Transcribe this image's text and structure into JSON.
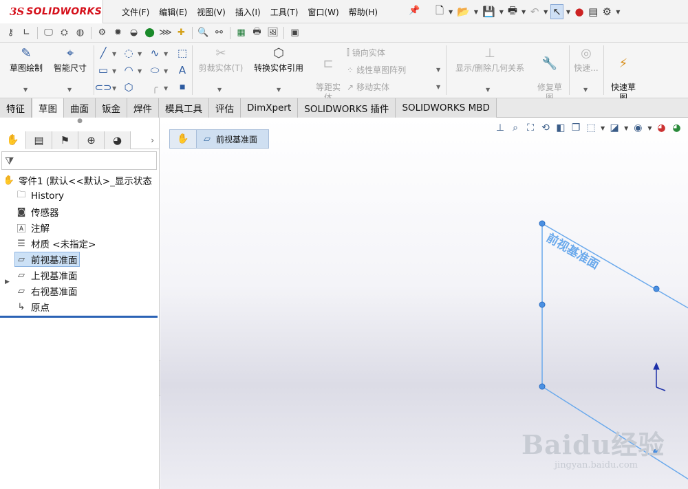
{
  "app": {
    "logo_ds": "3S",
    "logo_word": "SOLIDWORKS"
  },
  "menu": [
    "文件(F)",
    "编辑(E)",
    "视图(V)",
    "插入(I)",
    "工具(T)",
    "窗口(W)",
    "帮助(H)"
  ],
  "command_manager": {
    "sketch": "草图绘制",
    "smart_dimension": "智能尺寸",
    "trim": "剪裁实体(T)",
    "convert": "转换实体引用",
    "offset": "等距实\n体",
    "mirror": "镜向实体",
    "linear_pattern": "线性草图阵列",
    "move": "移动实体",
    "relations": "显示/删除几何关系",
    "repair": "修复草\n图",
    "quick_snaps": "快速...",
    "rapid_sketch": "快速草\n图"
  },
  "tabs": [
    {
      "label": "特征",
      "active": false
    },
    {
      "label": "草图",
      "active": true
    },
    {
      "label": "曲面",
      "active": false
    },
    {
      "label": "钣金",
      "active": false
    },
    {
      "label": "焊件",
      "active": false
    },
    {
      "label": "模具工具",
      "active": false
    },
    {
      "label": "评估",
      "active": false
    },
    {
      "label": "DimXpert",
      "active": false
    },
    {
      "label": "SOLIDWORKS 插件",
      "active": false
    },
    {
      "label": "SOLIDWORKS MBD",
      "active": false
    }
  ],
  "feature_tree": {
    "part": "零件1 (默认<<默认>_显示状态",
    "history": "History",
    "sensors": "传感器",
    "annotations": "注解",
    "material": "材质 <未指定>",
    "front_plane": "前视基准面",
    "top_plane": "上视基准面",
    "right_plane": "右视基准面",
    "origin": "原点"
  },
  "graphics": {
    "breadcrumb": "前视基准面",
    "plane_label": "前视基准面",
    "plane_color": "#6aa9ec"
  },
  "watermark": {
    "main": "Baidu经验",
    "sub": "jingyan.baidu.com"
  },
  "colors": {
    "accent": "#2a62b5",
    "brand": "#d5101b",
    "arrow": "#e8413a"
  }
}
